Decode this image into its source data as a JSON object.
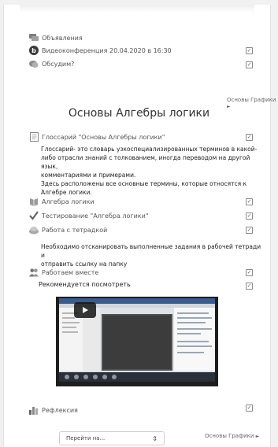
{
  "items": {
    "announcements": "Объявления",
    "videoconf": "Видеоконференция 20.04.2020 в 16:30",
    "discuss": "Обсудим?",
    "glossary": "Глоссарий \"Основы Алгебры логики\"",
    "algebra": "Алгебра логики",
    "test": "Тестирование \"Алгебра логики\"",
    "notebook": "Работа с тетрадкой",
    "together": "Работаем вместе",
    "recommend": "Рекомендуется посмотреть",
    "reflection": "Рефлексия"
  },
  "section": {
    "title": "Основы Алгебры логики",
    "nav_prev_top": "Основы Графики",
    "nav_prev_bottom": "Основы Графики"
  },
  "descriptions": {
    "glossary_line1": "Глоссарий- это словарь узкоспециализированных терминов в какой-",
    "glossary_line2": "либо отрасли знаний с толкованием, иногда переводом на другой язык,",
    "glossary_line3": "комментариями и примерами.",
    "glossary_line4": "Здесь расположены все основные термины, которые относятся к",
    "glossary_line5": "Алгебре логики.",
    "notebook_line1": "Необходимо отсканировать выполненные задания в рабочей тетради и",
    "notebook_line2": "отправить ссылку на папку"
  },
  "jump": {
    "label": "Перейти на...",
    "arrow": "⇕"
  },
  "icons": {
    "check": "✓",
    "nav_arrow": "►"
  }
}
